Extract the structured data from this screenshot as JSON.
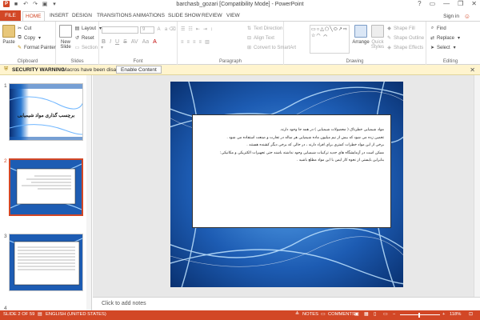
{
  "window": {
    "title": "barchasb_gozari [Compatibility Mode] - PowerPoint",
    "help": "?",
    "controls": [
      "▭",
      "—",
      "❐",
      "✕"
    ]
  },
  "tabs": {
    "file": "FILE",
    "items": [
      "HOME",
      "INSERT",
      "DESIGN",
      "TRANSITIONS",
      "ANIMATIONS",
      "SLIDE SHOW",
      "REVIEW",
      "VIEW"
    ],
    "active": "HOME",
    "signin": "Sign in"
  },
  "ribbon": {
    "clipboard": {
      "label": "Clipboard",
      "paste": "Paste",
      "cut": "Cut",
      "copy": "Copy",
      "format_painter": "Format Painter"
    },
    "slides": {
      "label": "Slides",
      "new_slide": "New Slide",
      "layout": "Layout",
      "reset": "Reset",
      "section": "Section"
    },
    "font": {
      "label": "Font",
      "size": "9"
    },
    "paragraph": {
      "label": "Paragraph",
      "text_direction": "Text Direction",
      "align_text": "Align Text",
      "convert": "Convert to SmartArt"
    },
    "drawing": {
      "label": "Drawing",
      "arrange": "Arrange",
      "quick_styles": "Quick Styles",
      "shape_fill": "Shape Fill",
      "shape_outline": "Shape Outline",
      "shape_effects": "Shape Effects"
    },
    "editing": {
      "label": "Editing",
      "find": "Find",
      "replace": "Replace",
      "select": "Select"
    }
  },
  "security_bar": {
    "label": "SECURITY WARNING",
    "message": "Macros have been disabled.",
    "button": "Enable Content"
  },
  "thumbnails": [
    {
      "number": "1",
      "title": "برچسب گذاری مواد شیمیایی"
    },
    {
      "number": "2",
      "title": ""
    },
    {
      "number": "3",
      "title": ""
    }
  ],
  "slide": {
    "lines": [
      "مواد شیمیایی خطرناک ( محصولات شیمیایی ) در همه جا وجود دارند.",
      "تخمین زده می شود که بیش از نیم میلیون ماده شیمیایی هر ساله در تجارت و صنعت استفاده می شود .",
      "برخی از این مواد خطرات کمتری برای افراد دارند ، در حالی که برخی دیگر کشنده هستند .",
      "ممکن است در آزمایشگاه های جدید ترکیبات شیمیایی وجود نداشته باشند حتی تجهیزات الکتریکی و مکانیکی:",
      "بنابراین بایستی از نحوه کار ایمن با این مواد مطلع باشید ."
    ]
  },
  "notes": {
    "placeholder": "Click to add notes"
  },
  "status": {
    "slide": "SLIDE 2 OF 59",
    "language": "ENGLISH (UNITED STATES)",
    "notes": "NOTES",
    "comments": "COMMENTS",
    "zoom": "118%"
  },
  "colors": {
    "accent": "#d24726",
    "security_bg": "#fff4ce"
  }
}
